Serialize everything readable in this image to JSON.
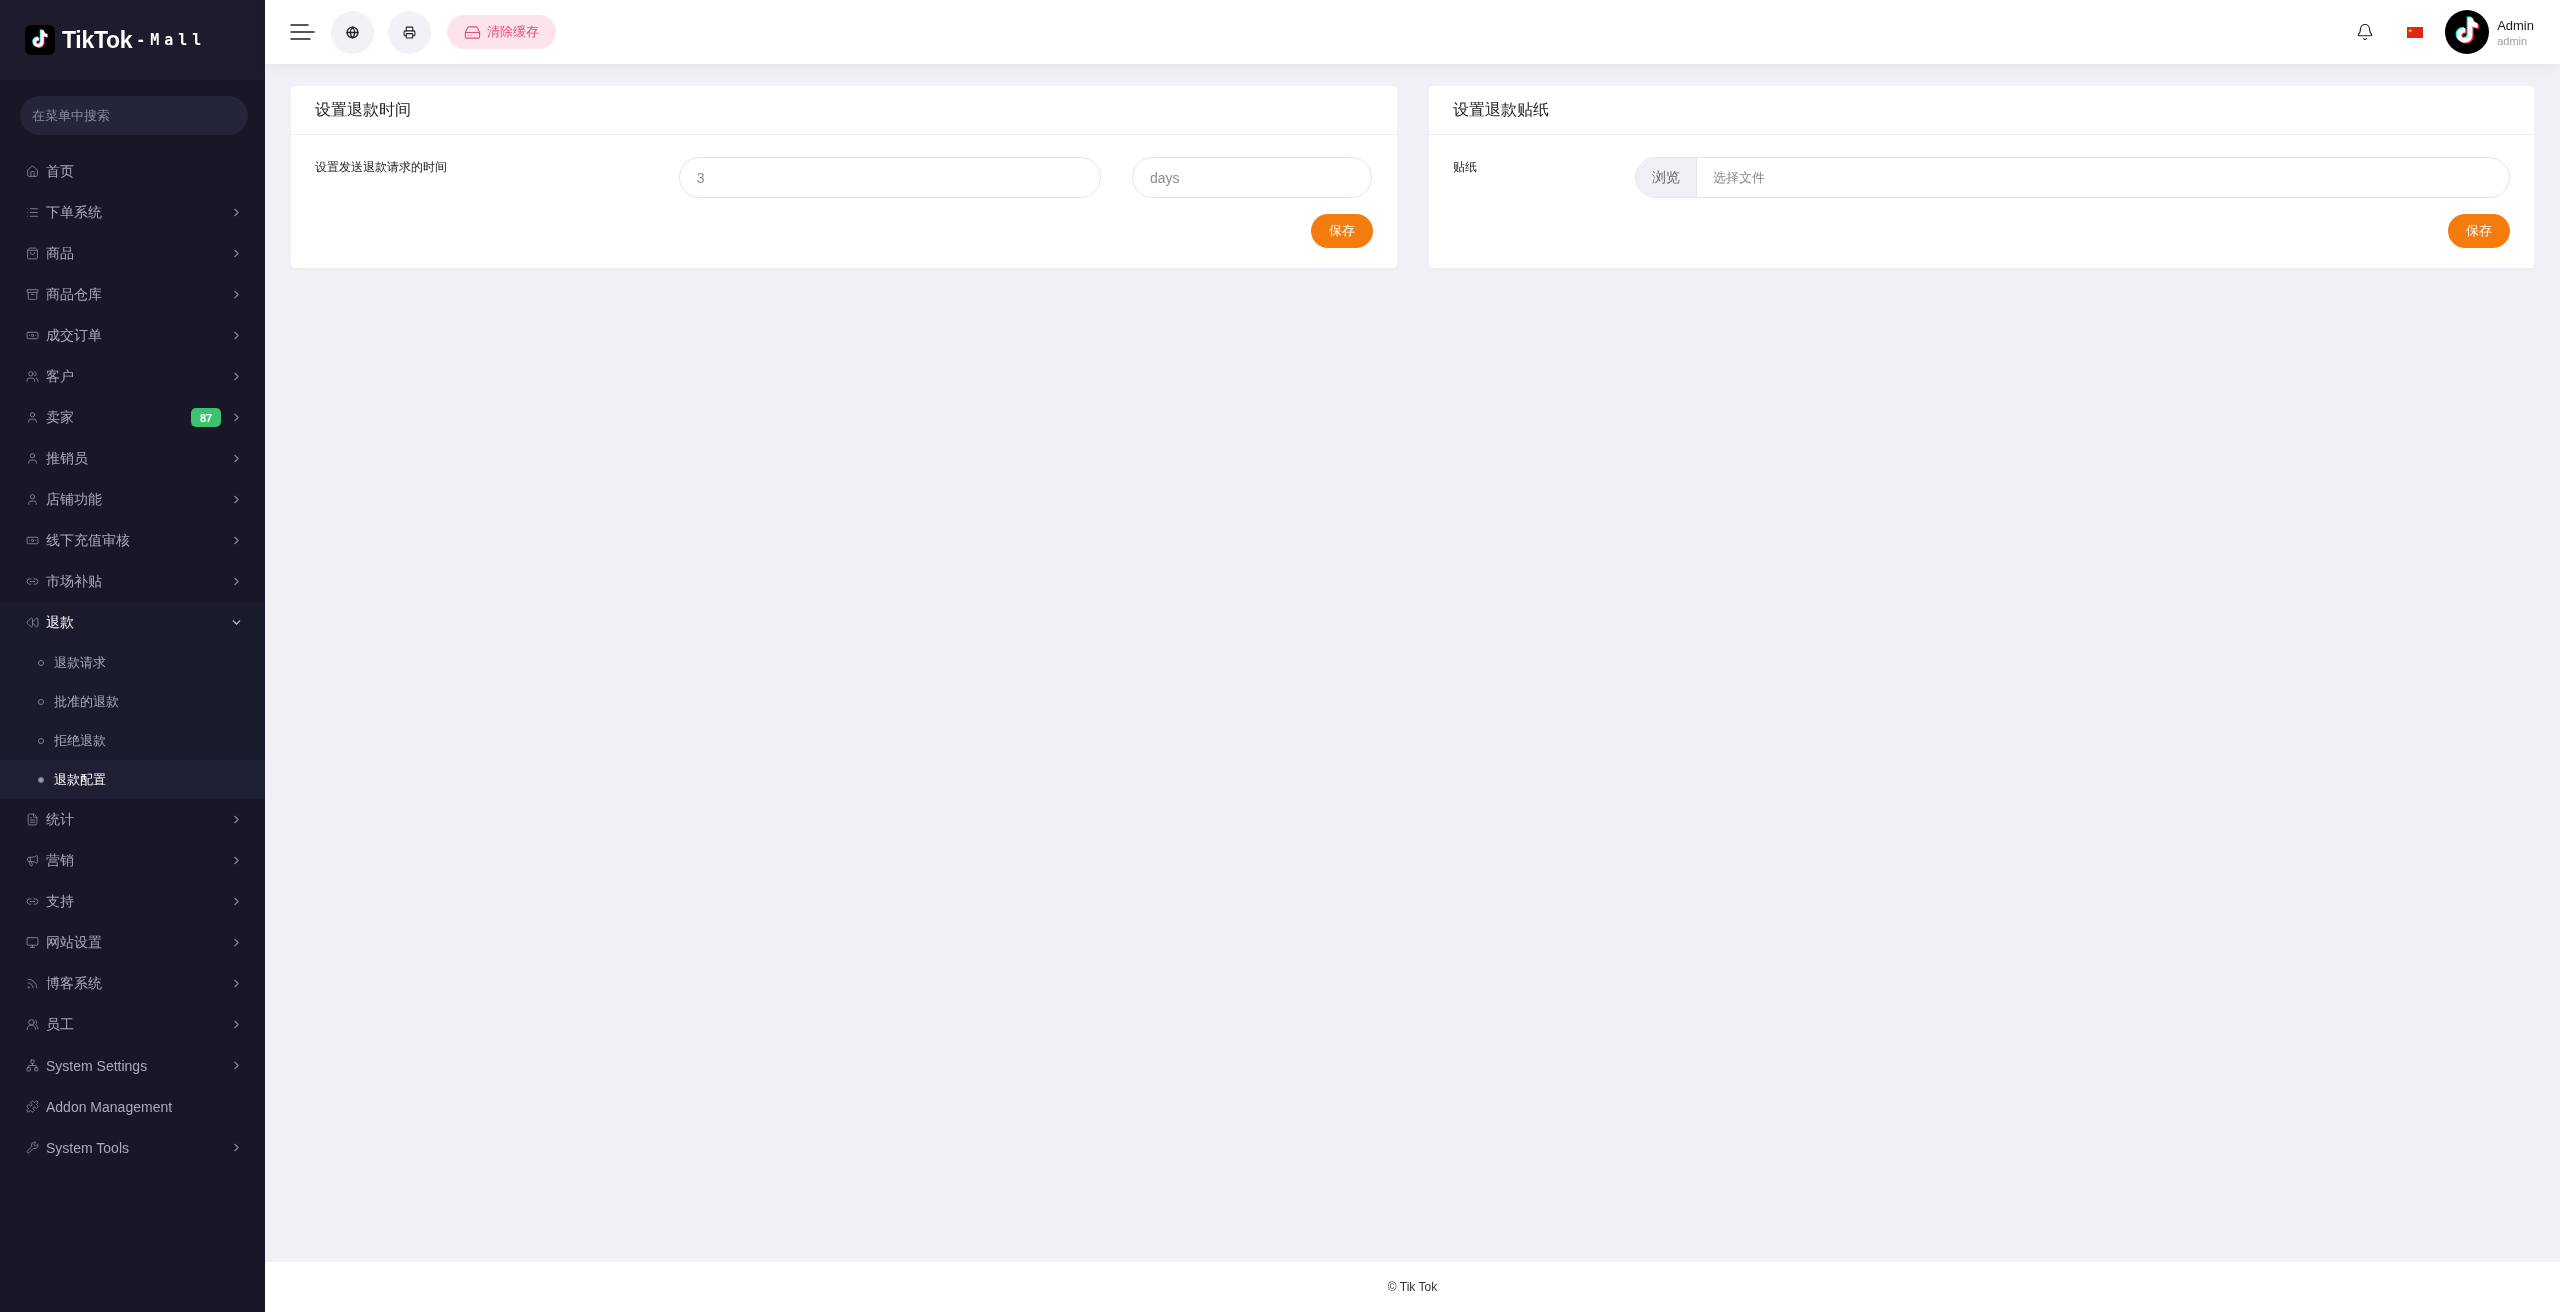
{
  "sidebar": {
    "logo": {
      "title": "TikTok",
      "suffix": "-Mall"
    },
    "search": {
      "placeholder": "在菜单中搜索"
    },
    "items": [
      {
        "label": "首页"
      },
      {
        "label": "下单系统",
        "expanded": false
      },
      {
        "label": "商品",
        "expanded": false
      },
      {
        "label": "商品仓库",
        "expanded": false
      },
      {
        "label": "成交订单",
        "expanded": false
      },
      {
        "label": "客户",
        "expanded": false
      },
      {
        "label": "卖家",
        "expanded": false,
        "badge": "87"
      },
      {
        "label": "推销员",
        "expanded": false
      },
      {
        "label": "店铺功能",
        "expanded": false
      },
      {
        "label": "线下充值审核",
        "expanded": false
      },
      {
        "label": "市场补贴",
        "expanded": false
      },
      {
        "label": "退款",
        "expanded": true,
        "children": [
          {
            "label": "退款请求",
            "selected": false
          },
          {
            "label": "批准的退款",
            "selected": false
          },
          {
            "label": "拒绝退款",
            "selected": false
          },
          {
            "label": "退款配置",
            "selected": true
          }
        ]
      },
      {
        "label": "统计",
        "expanded": false
      },
      {
        "label": "营销",
        "expanded": false
      },
      {
        "label": "支持",
        "expanded": false
      },
      {
        "label": "网站设置",
        "expanded": false
      },
      {
        "label": "博客系统",
        "expanded": false
      },
      {
        "label": "员工",
        "expanded": false
      },
      {
        "label": "System Settings",
        "expanded": false
      },
      {
        "label": "Addon Management"
      },
      {
        "label": "System Tools",
        "expanded": false
      }
    ]
  },
  "topbar": {
    "clear_cache": "清除缓存",
    "user": {
      "name": "Admin",
      "role": "admin"
    }
  },
  "cards": [
    {
      "title": "设置退款时间",
      "label": "设置发送退款请求的时间",
      "fields": [
        {
          "kind": "text",
          "value": "3"
        },
        {
          "kind": "text",
          "value": "days"
        }
      ],
      "button": "保存"
    },
    {
      "title": "设置退款贴纸",
      "label": "贴纸",
      "fields": [
        {
          "kind": "file",
          "button": "浏览",
          "placeholder": "选择文件"
        }
      ],
      "button": "保存"
    }
  ],
  "footer": "© Tik Tok"
}
